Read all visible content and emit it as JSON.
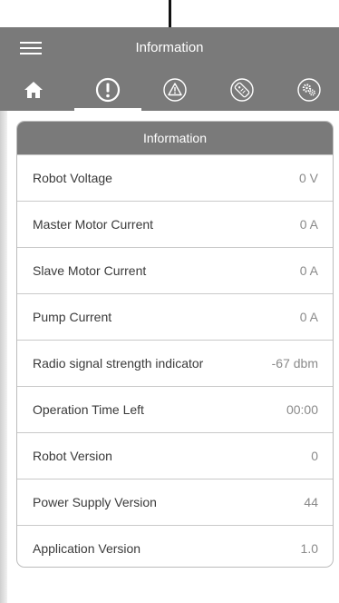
{
  "header": {
    "title": "Information"
  },
  "tabs": [
    {
      "icon": "home-icon",
      "active": false
    },
    {
      "icon": "info-alert-icon",
      "active": true
    },
    {
      "icon": "warning-icon",
      "active": false
    },
    {
      "icon": "remote-icon",
      "active": false
    },
    {
      "icon": "settings-icon",
      "active": false
    }
  ],
  "card": {
    "title": "Information",
    "rows": [
      {
        "label": "Robot Voltage",
        "value": "0 V"
      },
      {
        "label": "Master Motor Current",
        "value": "0 A"
      },
      {
        "label": "Slave Motor Current",
        "value": "0 A"
      },
      {
        "label": "Pump Current",
        "value": "0 A"
      },
      {
        "label": "Radio signal strength indicator",
        "value": "-67 dbm"
      },
      {
        "label": "Operation Time Left",
        "value": "00:00"
      },
      {
        "label": "Robot Version",
        "value": "0"
      },
      {
        "label": "Power Supply Version",
        "value": "44"
      },
      {
        "label": "Application Version",
        "value": "1.0"
      }
    ]
  },
  "colors": {
    "header_bg": "#7a7a7a",
    "icon": "#ffffff",
    "border": "#c9c9c9"
  }
}
